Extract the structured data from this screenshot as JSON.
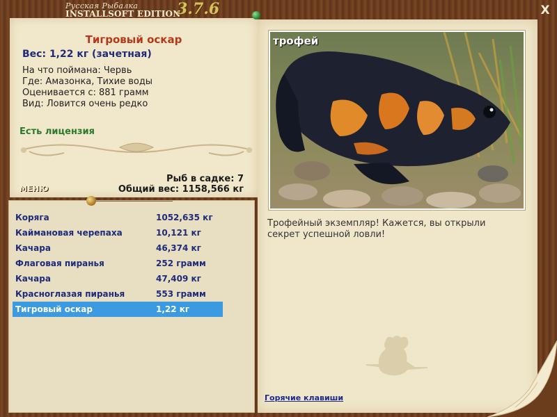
{
  "window": {
    "title_line1": "Русская Рыбалка",
    "title_line2": "INSTALLSOFT EDITION",
    "version": "3.7.6",
    "close_label": "X"
  },
  "catch": {
    "name": "Тигровый оскар",
    "weight_line": "Вес: 1,22 кг (зачетная)",
    "bait_line": "На что поймана: Червь",
    "location_line": "Где: Амазонка, Тихие воды",
    "rated_line": "Оценивается с: 881 грамм",
    "kind_line": "Вид: Ловится очень редко",
    "license": "Есть лицензия"
  },
  "keepnet": {
    "count_line": "Рыб в садке: 7",
    "total_line": "Общий вес: 1158,566 кг"
  },
  "menu_label": "МЕНЮ",
  "photo_label": "трофей",
  "description": "Трофейный экземпляр! Кажется, вы открыли секрет успешной ловли!",
  "hotkeys_label": "Горячие клавиши",
  "list": [
    {
      "name": "Коряга",
      "weight": "1052,635 кг"
    },
    {
      "name": "Каймановая черепаха",
      "weight": "10,121 кг"
    },
    {
      "name": "Качара",
      "weight": "46,374 кг"
    },
    {
      "name": "Флаговая пиранья",
      "weight": "252 грамм"
    },
    {
      "name": "Качара",
      "weight": "47,409 кг"
    },
    {
      "name": "Красноглазая пиранья",
      "weight": "553 грамм"
    },
    {
      "name": "Тигровый оскар",
      "weight": "1,22 кг"
    }
  ],
  "selected_index": 6,
  "colors": {
    "accent_title": "#b23a1a",
    "text_blue": "#1e2a7a",
    "license_green": "#2c7a2c",
    "selection": "#3b9ae0"
  }
}
